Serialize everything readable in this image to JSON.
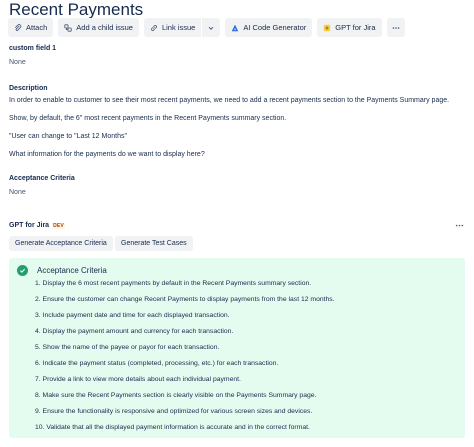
{
  "page": {
    "title": "Recent Payments"
  },
  "toolbar": {
    "attach": "Attach",
    "add_child": "Add a child issue",
    "link_issue": "Link issue",
    "ai_code": "AI Code Generator",
    "gpt_jira": "GPT for Jira"
  },
  "fields": {
    "custom_label": "custom field 1",
    "custom_value": "None",
    "description_label": "Description",
    "description_paragraphs": [
      "In order to enable to customer to see their most recent payments, we need to add a recent payments section to the Payments Summary page.",
      "Show, by default, the 6\" most recent payments in the Recent Payments summary section.",
      "\"User can change to \"Last 12 Months\"",
      "What information for the payments do we want to display here?"
    ],
    "acceptance_label": "Acceptance Criteria",
    "acceptance_value": "None"
  },
  "gpt": {
    "title": "GPT for Jira",
    "badge": "DEV",
    "generate_ac": "Generate Acceptance Criteria",
    "generate_tests": "Generate Test Cases",
    "panel_title": "Acceptance Criteria",
    "criteria": [
      "1. Display the 6 most recent payments by default in the Recent Payments summary section.",
      "2. Ensure the customer can change Recent Payments to display payments from the last 12 months.",
      "3. Include payment date and time for each displayed transaction.",
      "4. Display the payment amount and currency for each transaction.",
      "5. Show the name of the payee or payor for each transaction.",
      "6. Indicate the payment status (completed, processing, etc.) for each transaction.",
      "7. Provide a link to view more details about each individual payment.",
      "8. Make sure the Recent Payments section is clearly visible on the Payments Summary page.",
      "9. Ensure the functionality is responsive and optimized for various screen sizes and devices.",
      "10. Validate that all the displayed payment information is accurate and in the correct format."
    ]
  },
  "colors": {
    "panel_bg": "#e3fcef",
    "success": "#22a06b",
    "button_bg": "#f1f2f4",
    "text": "#172b4d"
  }
}
